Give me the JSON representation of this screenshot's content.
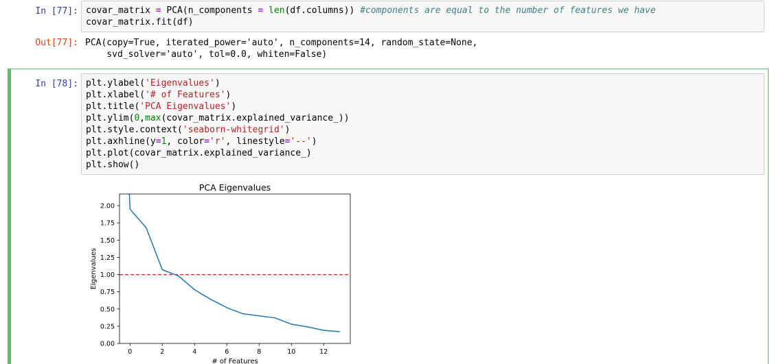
{
  "cells": [
    {
      "prompt": "In [77]:",
      "lines": [
        [
          [
            "n",
            "covar_matrix "
          ],
          [
            "o",
            "="
          ],
          [
            "n",
            " PCA(n_components "
          ],
          [
            "o",
            "="
          ],
          [
            "n",
            " "
          ],
          [
            "bi",
            "len"
          ],
          [
            "n",
            "(df.columns)) "
          ],
          [
            "c",
            "#components are equal to the number of features we have"
          ]
        ],
        [
          [
            "n",
            "covar_matrix.fit(df)"
          ]
        ]
      ],
      "output_prompt": "Out[77]:",
      "output_lines": [
        "PCA(copy=True, iterated_power='auto', n_components=14, random_state=None,",
        "    svd_solver='auto', tol=0.0, whiten=False)"
      ]
    },
    {
      "prompt": "In [78]:",
      "lines": [
        [
          [
            "n",
            "plt.ylabel("
          ],
          [
            "s",
            "'Eigenvalues'"
          ],
          [
            "n",
            ")"
          ]
        ],
        [
          [
            "n",
            "plt.xlabel("
          ],
          [
            "s",
            "'# of Features'"
          ],
          [
            "n",
            ")"
          ]
        ],
        [
          [
            "n",
            "plt.title("
          ],
          [
            "s",
            "'PCA Eigenvalues'"
          ],
          [
            "n",
            ")"
          ]
        ],
        [
          [
            "n",
            "plt.ylim("
          ],
          [
            "num",
            "0"
          ],
          [
            "n",
            ","
          ],
          [
            "bi",
            "max"
          ],
          [
            "n",
            "(covar_matrix.explained_variance_))"
          ]
        ],
        [
          [
            "n",
            "plt.style.context("
          ],
          [
            "s",
            "'seaborn-whitegrid'"
          ],
          [
            "n",
            ")"
          ]
        ],
        [
          [
            "n",
            "plt.axhline(y"
          ],
          [
            "o",
            "="
          ],
          [
            "num",
            "1"
          ],
          [
            "n",
            ", color"
          ],
          [
            "o",
            "="
          ],
          [
            "s",
            "'r'"
          ],
          [
            "n",
            ", linestyle"
          ],
          [
            "o",
            "="
          ],
          [
            "s",
            "'--'"
          ],
          [
            "n",
            ")"
          ]
        ],
        [
          [
            "n",
            "plt.plot(covar_matrix.explained_variance_)"
          ]
        ],
        [
          [
            "n",
            "plt.show()"
          ]
        ]
      ]
    }
  ],
  "colors": {
    "line": "#1f77b4",
    "axhline": "#d62728",
    "selected_border": "#66bb6a"
  },
  "chart_data": {
    "type": "line",
    "title": "PCA Eigenvalues",
    "xlabel": "# of Features",
    "ylabel": "Eigenvalues",
    "x": [
      0,
      1,
      2,
      3,
      4,
      5,
      6,
      7,
      8,
      9,
      10,
      11,
      12,
      13
    ],
    "series": [
      {
        "values": [
          2.23,
          1.95,
          1.68,
          1.07,
          0.98,
          0.78,
          0.64,
          0.52,
          0.43,
          0.4,
          0.37,
          0.28,
          0.24,
          0.19,
          0.17
        ]
      }
    ],
    "axhline": {
      "y": 1,
      "color": "r",
      "linestyle": "--"
    },
    "xlim": [
      -0.65,
      13.65
    ],
    "ylim": [
      0,
      2.17
    ],
    "xticks": [
      0,
      2,
      4,
      6,
      8,
      10,
      12
    ],
    "xtick_labels": [
      "0",
      "2",
      "4",
      "6",
      "8",
      "10",
      "12"
    ],
    "yticks": [
      0,
      0.25,
      0.5,
      0.75,
      1.0,
      1.25,
      1.5,
      1.75,
      2.0
    ],
    "ytick_labels": [
      "0.00",
      "0.25",
      "0.50",
      "0.75",
      "1.00",
      "1.25",
      "1.50",
      "1.75",
      "2.00"
    ],
    "grid": false
  }
}
